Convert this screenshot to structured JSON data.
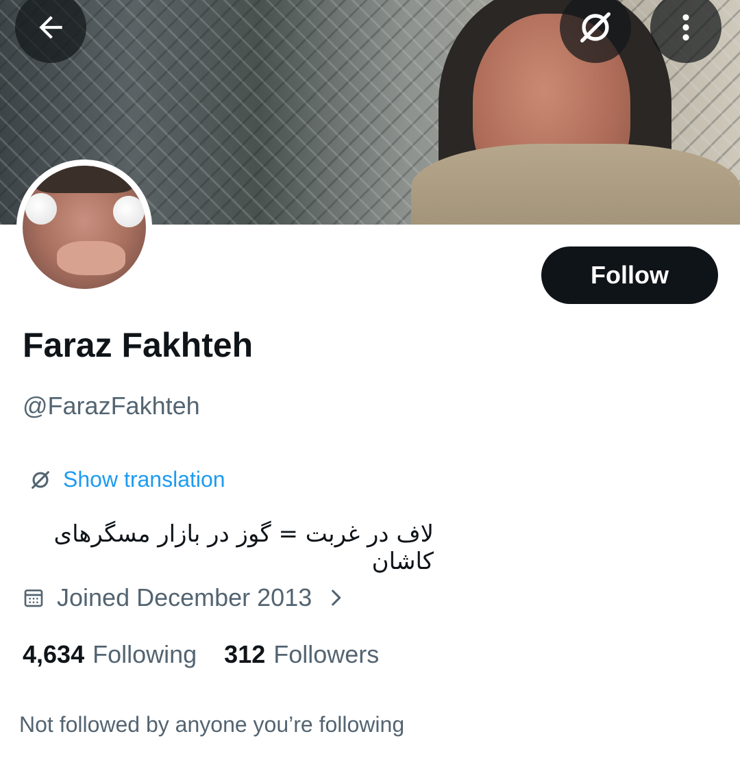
{
  "header": {
    "back_icon": "arrow-left-icon",
    "translate_icon": "translate-slash-icon",
    "more_icon": "more-vertical-icon"
  },
  "profile": {
    "display_name": "Faraz Fakhteh",
    "handle": "@FarazFakhteh",
    "follow_label": "Follow",
    "show_translation_label": "Show translation",
    "bio": "لاف در غربت = گوز در بازار مسگرهای کاشان",
    "joined_label": "Joined December 2013",
    "following_count": "4,634",
    "following_label": "Following",
    "followers_count": "312",
    "followers_label": "Followers",
    "mutuals_text": "Not followed by anyone you’re following"
  },
  "colors": {
    "primary_text": "#0f1419",
    "secondary_text": "#536471",
    "link": "#1d9bf0",
    "follow_button_bg": "#0f1419"
  }
}
